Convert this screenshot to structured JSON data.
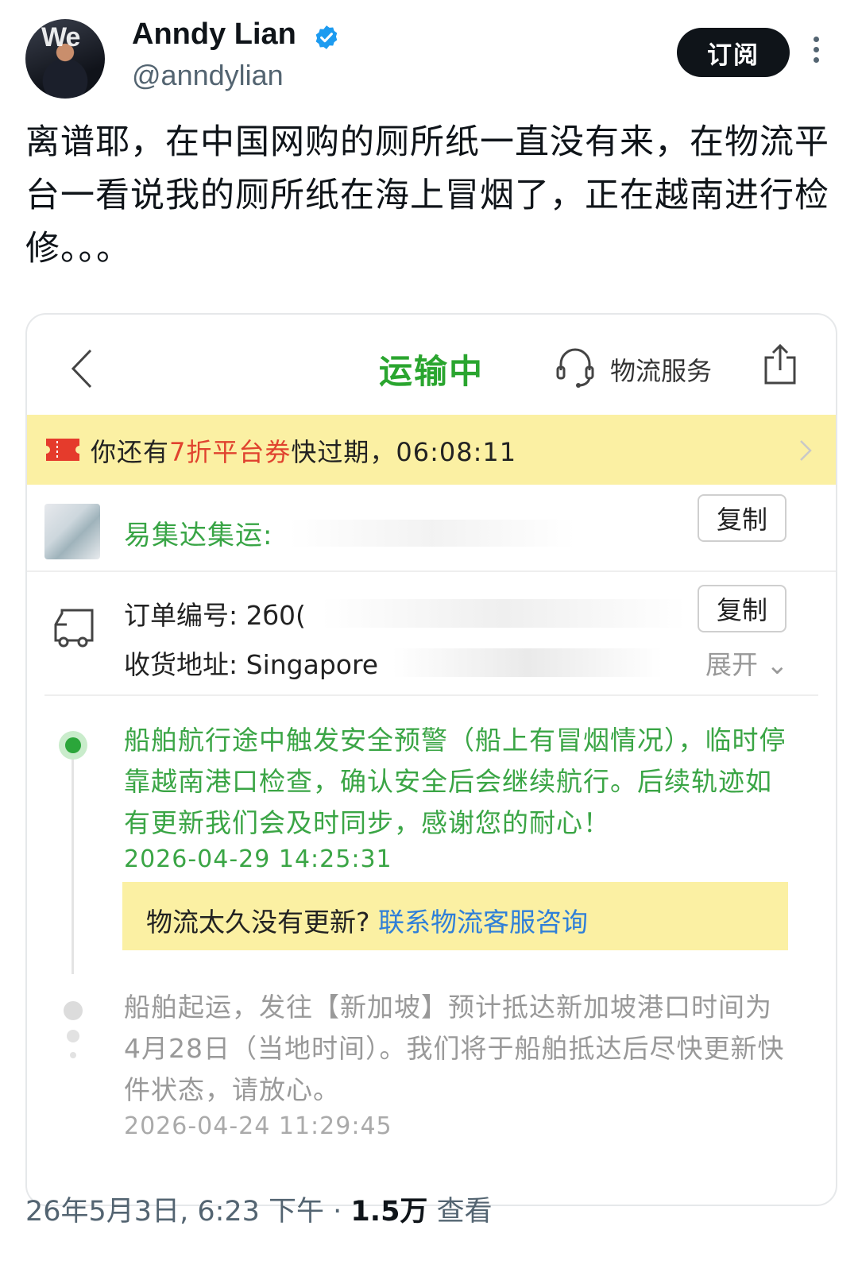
{
  "author": {
    "display_name": "Anndy Lian",
    "handle": "@anndylian",
    "verified_color": "#1d9bf0"
  },
  "subscribe_label": "订阅",
  "tweet": {
    "text": "离谱耶，在中国网购的厕所纸一直没有来，在物流平台一看说我的厕所纸在海上冒烟了，正在越南进行检修。。。"
  },
  "logistics": {
    "nav_title": "运输中",
    "service_label": "物流服务",
    "coupon": {
      "prefix": "你还有",
      "highlight": "7折平台券",
      "suffix": "快过期，",
      "countdown": "06:08:11"
    },
    "courier": {
      "label": "易集达集运:",
      "copy_label": "复制"
    },
    "order": {
      "number_label": "订单编号:",
      "number_visible": "2б0(",
      "copy_label": "复制",
      "address_label": "收货地址:",
      "address_visible": "Singapore",
      "expand_label": "展开"
    },
    "events": [
      {
        "text": "船舶航行途中触发安全预警（船上有冒烟情况），临时停靠越南港口检查，确认安全后会继续航行。后续轨迹如有更新我们会及时同步，感谢您的耐心！",
        "time": "2026-04-29 14:25:31"
      },
      {
        "text": "船舶起运，发往【新加坡】预计抵达新加坡港口时间为 4月28日（当地时间）。我们将于船舶抵达后尽快更新快件状态，请放心。",
        "time": "2026-04-24 11:29:45"
      }
    ],
    "help": {
      "question": "物流太久没有更新?",
      "link": "联系物流客服咨询"
    },
    "colors": {
      "accent_green": "#2aa52f",
      "banner_yellow": "#fbf0a3",
      "coupon_red": "#e0432f",
      "link_blue": "#2f7fd8"
    }
  },
  "footer": {
    "timestamp": "26年5月3日, 6:23 下午 · ",
    "views": "1.5万",
    "views_label": " 查看"
  }
}
